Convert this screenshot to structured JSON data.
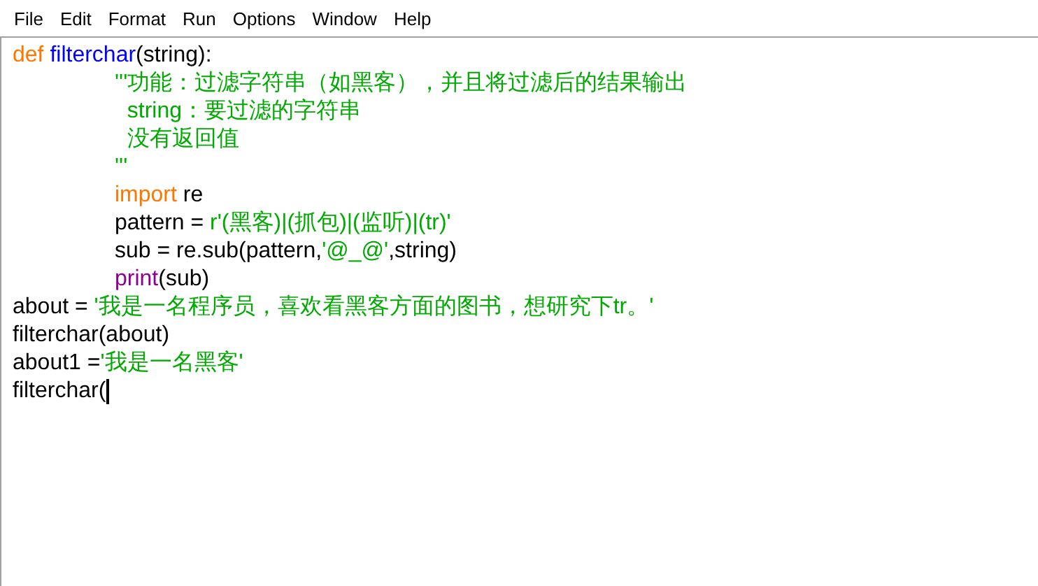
{
  "menu_bar": [
    {
      "label": "File"
    },
    {
      "label": "Edit"
    },
    {
      "label": "Format"
    },
    {
      "label": "Run"
    },
    {
      "label": "Options"
    },
    {
      "label": "Window"
    },
    {
      "label": "Help"
    }
  ],
  "editor": {
    "lines": [
      {
        "tokens": [
          {
            "kind": "keyword",
            "text": "def "
          },
          {
            "kind": "definition",
            "text": "filterchar"
          },
          {
            "kind": "plain",
            "text": "(string):"
          }
        ]
      },
      {
        "tokens": [
          {
            "kind": "string",
            "text": "\t'''功能：过滤字符串（如黑客），并且将过滤后的结果输出"
          }
        ]
      },
      {
        "tokens": [
          {
            "kind": "string",
            "text": "\t  string：要过滤的字符串"
          }
        ]
      },
      {
        "tokens": [
          {
            "kind": "string",
            "text": "\t  没有返回值"
          }
        ]
      },
      {
        "tokens": [
          {
            "kind": "string",
            "text": "\t'''"
          }
        ]
      },
      {
        "tokens": [
          {
            "kind": "keyword",
            "text": "\timport"
          },
          {
            "kind": "plain",
            "text": " re"
          }
        ]
      },
      {
        "tokens": [
          {
            "kind": "plain",
            "text": "\tpattern = "
          },
          {
            "kind": "string",
            "text": "r'(黑客)|(抓包)|(监听)|(tr)'"
          }
        ]
      },
      {
        "tokens": [
          {
            "kind": "plain",
            "text": "\tsub = re.sub(pattern,"
          },
          {
            "kind": "string",
            "text": "'@_@'"
          },
          {
            "kind": "plain",
            "text": ",string)"
          }
        ]
      },
      {
        "tokens": [
          {
            "kind": "builtin",
            "text": "\tprint"
          },
          {
            "kind": "plain",
            "text": "(sub)"
          }
        ]
      },
      {
        "tokens": [
          {
            "kind": "plain",
            "text": "about = "
          },
          {
            "kind": "string",
            "text": "'我是一名程序员，喜欢看黑客方面的图书，想研究下tr。'"
          }
        ]
      },
      {
        "tokens": [
          {
            "kind": "plain",
            "text": "filterchar(about)"
          }
        ]
      },
      {
        "tokens": [
          {
            "kind": "plain",
            "text": "about1 ="
          },
          {
            "kind": "string",
            "text": "'我是一名黑客'"
          }
        ]
      },
      {
        "cursor": true,
        "tokens": [
          {
            "kind": "plain",
            "text": "filterchar("
          }
        ]
      }
    ]
  }
}
